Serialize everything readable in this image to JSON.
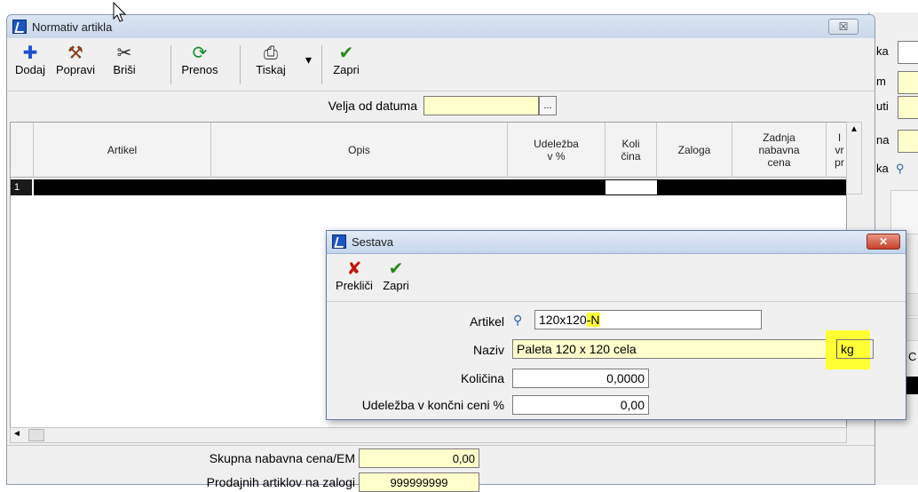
{
  "main_window": {
    "title": "Normativ artikla",
    "close_symbol": "☒",
    "toolbar": [
      {
        "label": "Dodaj",
        "icon": "plus-icon",
        "glyph": "✚"
      },
      {
        "label": "Popravi",
        "icon": "hammer-icon",
        "glyph": "⚒"
      },
      {
        "label": "Briši",
        "icon": "scissors-icon",
        "glyph": "✂"
      },
      {
        "label": "Prenos",
        "icon": "transfer-icon",
        "glyph": "⟳"
      },
      {
        "label": "Tiskaj",
        "icon": "printer-icon",
        "glyph": "⎙"
      },
      {
        "label": "Zapri",
        "icon": "checkmark-icon",
        "glyph": "✔"
      }
    ],
    "tiskaj_dropdown": "▾",
    "date_label": "Velja od datuma",
    "date_value": "",
    "date_button": "...",
    "grid": {
      "headers": [
        "Artikel",
        "Opis",
        "Udeležba\nv %",
        "Koli\nčina",
        "Zaloga",
        "Zadnja\nnabavna\ncena",
        "I\nvr\npr"
      ],
      "row_number": "1"
    },
    "scroll_up": "▲",
    "scroll_left": "◄",
    "footer": {
      "total_label": "Skupna nabavna cena/EM",
      "total_value": "0,00",
      "stock_label": "Prodajnih artiklov na zalogi",
      "stock_value": "999999999"
    }
  },
  "background_window": {
    "labels": [
      "ka",
      "m",
      "uti",
      "na",
      "ka"
    ],
    "extra_label": "C"
  },
  "dialog": {
    "title": "Sestava",
    "close_symbol": "✕",
    "toolbar": [
      {
        "label": "Prekliči",
        "icon": "cancel-x-icon",
        "glyph": "✘"
      },
      {
        "label": "Zapri",
        "icon": "checkmark-icon",
        "glyph": "✔"
      }
    ],
    "fields": {
      "artikel_label": "Artikel",
      "artikel_value_prefix": "120x120",
      "artikel_value_suffix": "-N",
      "naziv_label": "Naziv",
      "naziv_value": "Paleta 120 x 120 cela",
      "unit_value": "kg",
      "kolicina_label": "Količina",
      "kolicina_value": "0,0000",
      "udelezba_label": "Udeležba v končni ceni %",
      "udelezba_value": "0,00"
    }
  },
  "colors": {
    "input_yellow": "#ffffcc",
    "highlight": "#ffff33",
    "dialog_close": "#c6412b"
  }
}
